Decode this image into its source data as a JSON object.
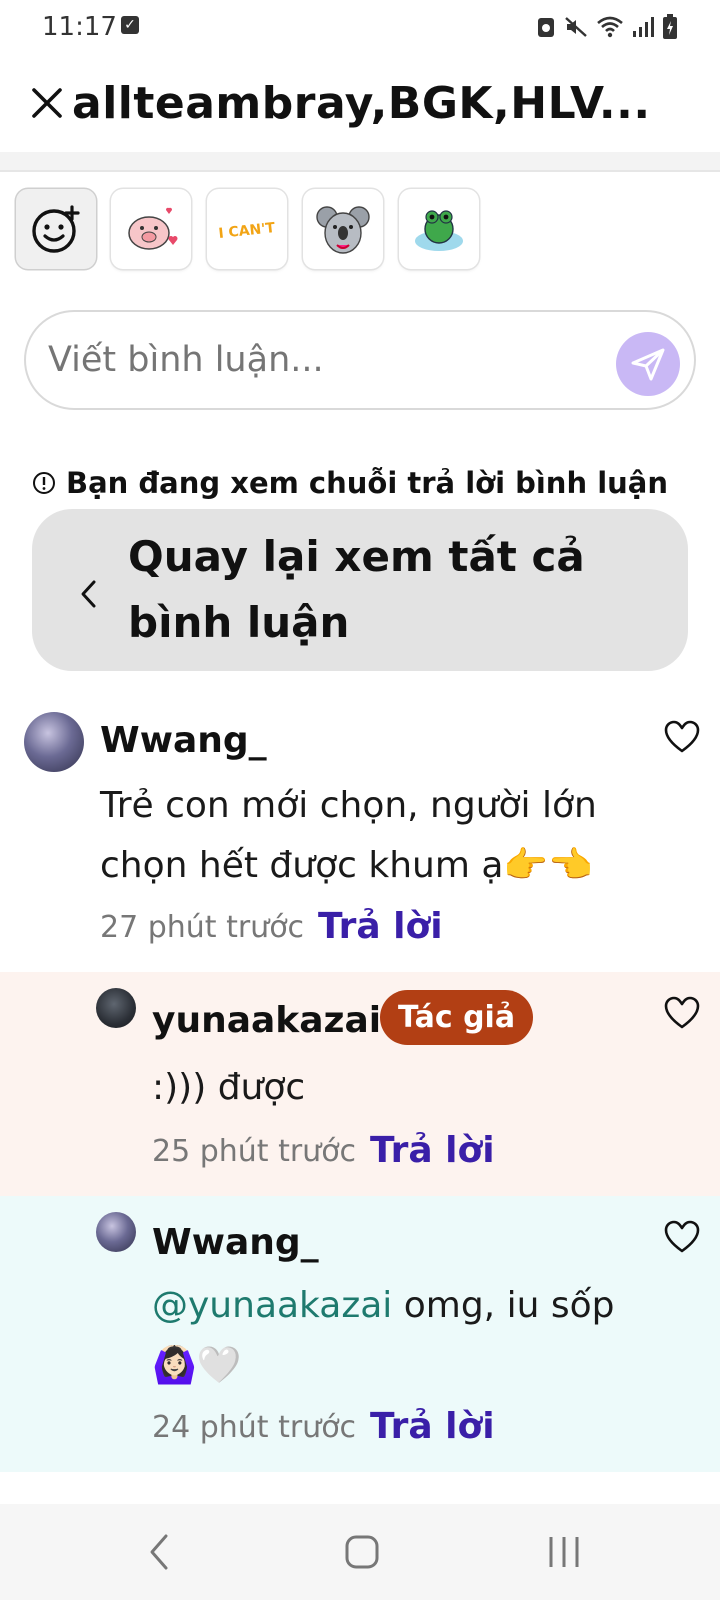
{
  "status_bar": {
    "time": "11:17"
  },
  "header": {
    "title": "allteambray,BGK,HLV..."
  },
  "input": {
    "placeholder": "Viết bình luận..."
  },
  "notice": {
    "text": "Bạn đang xem chuỗi trả lời bình luận"
  },
  "back_button": {
    "label": "Quay lại xem tất cả bình luận"
  },
  "comments": [
    {
      "username": "Wwang_",
      "text": "Trẻ con mới chọn, người lớn chọn hết được khum ạ👉👈",
      "time": "27 phút trước",
      "reply_label": "Trả lời"
    },
    {
      "username": "yunaakazai",
      "badge": "Tác giả",
      "text": ":))) được",
      "time": "25 phút trước",
      "reply_label": "Trả lời"
    },
    {
      "username": "Wwang_",
      "mention": "@yunaakazai",
      "text": " omg, iu sốp 🙆🏻‍♀️🤍",
      "time": "24 phút trước",
      "reply_label": "Trả lời"
    }
  ],
  "colors": {
    "accent_reply": "#3a1fa8",
    "badge_bg": "#b23f14",
    "send_button": "#c9b8f5",
    "reply_bg_author": "#fdf3ef",
    "reply_bg_user": "#edfafa",
    "mention": "#1e7a6e"
  },
  "icons": [
    "close-icon",
    "add-emoji-icon",
    "send-icon",
    "info-icon",
    "chevron-left-icon",
    "heart-icon",
    "nav-back-icon",
    "nav-home-icon",
    "nav-recents-icon"
  ]
}
